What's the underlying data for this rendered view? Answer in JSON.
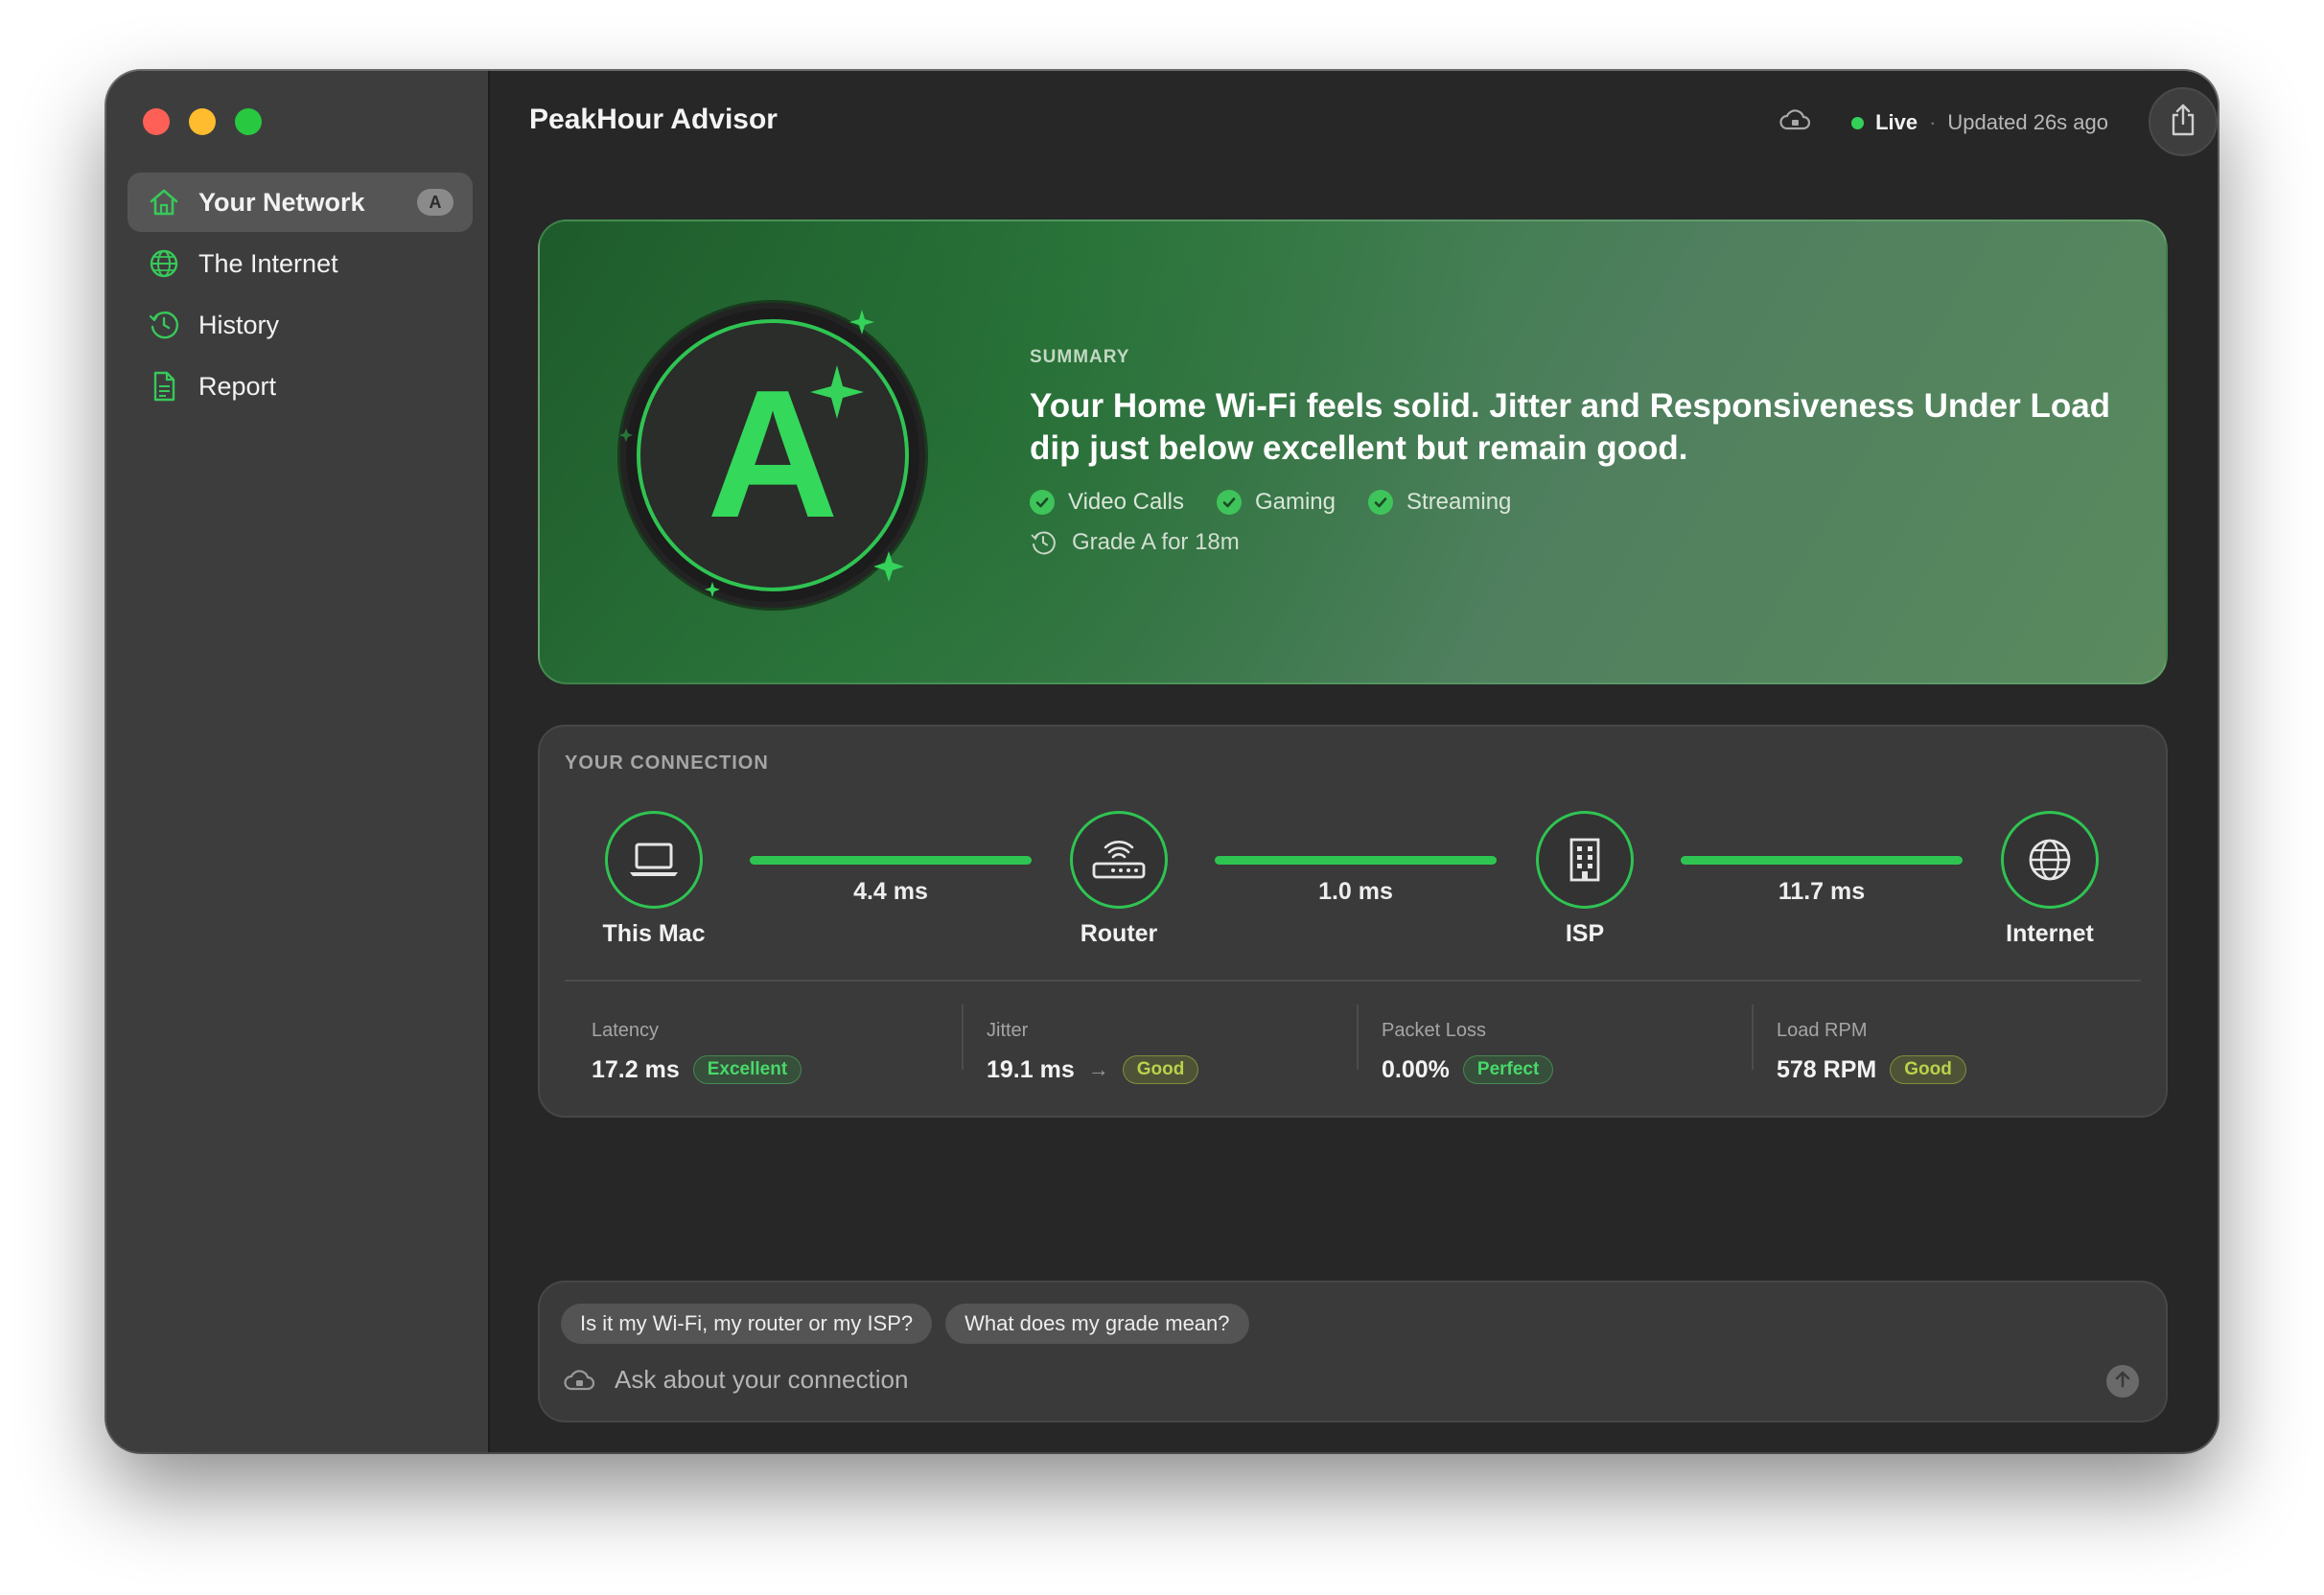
{
  "app": {
    "title": "PeakHour Advisor"
  },
  "sidebar": {
    "items": [
      {
        "label": "Your Network",
        "icon": "home-icon",
        "badge": "A",
        "active": true
      },
      {
        "label": "The Internet",
        "icon": "globe-icon"
      },
      {
        "label": "History",
        "icon": "history-icon"
      },
      {
        "label": "Report",
        "icon": "document-icon"
      }
    ]
  },
  "status": {
    "live_label": "Live",
    "separator": "·",
    "updated": "Updated 26s ago"
  },
  "summary": {
    "grade": "A",
    "label": "SUMMARY",
    "text": "Your Home Wi-Fi feels solid. Jitter and Responsiveness Under Load dip just below excellent but remain good.",
    "activities": [
      "Video Calls",
      "Gaming",
      "Streaming"
    ],
    "grade_since": "Grade A for 18m"
  },
  "connection": {
    "label": "YOUR CONNECTION",
    "nodes": [
      {
        "label": "This Mac",
        "icon": "laptop-icon"
      },
      {
        "label": "Router",
        "icon": "router-icon"
      },
      {
        "label": "ISP",
        "icon": "building-icon"
      },
      {
        "label": "Internet",
        "icon": "globe-icon"
      }
    ],
    "links": [
      "4.4 ms",
      "1.0 ms",
      "11.7 ms"
    ],
    "metrics": [
      {
        "label": "Latency",
        "value": "17.2 ms",
        "rating": "Excellent"
      },
      {
        "label": "Jitter",
        "value": "19.1 ms",
        "arrow": "→",
        "rating": "Good"
      },
      {
        "label": "Packet Loss",
        "value": "0.00%",
        "rating": "Perfect"
      },
      {
        "label": "Load RPM",
        "value": "578 RPM",
        "rating": "Good"
      }
    ]
  },
  "chat": {
    "suggestions": [
      "Is it my Wi-Fi, my router or my ISP?",
      "What does my grade mean?"
    ],
    "placeholder": "Ask about your connection"
  },
  "colors": {
    "accent": "#2fc452",
    "good": "#b9d24a",
    "window": "#272727",
    "sidebar": "#3d3d3d"
  }
}
